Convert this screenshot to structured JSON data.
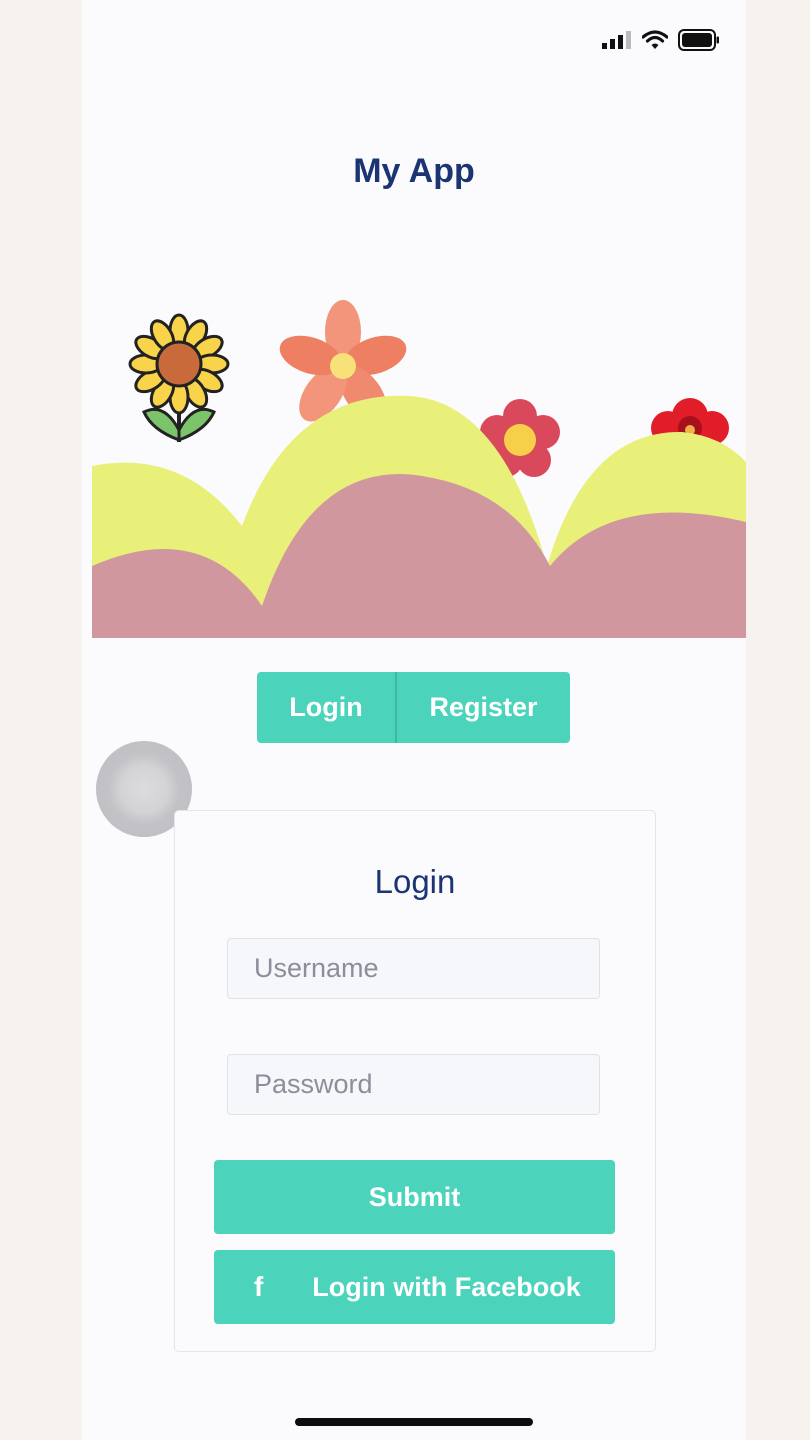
{
  "app": {
    "title": "My App"
  },
  "tabs": {
    "login_label": "Login",
    "register_label": "Register"
  },
  "login_card": {
    "title": "Login",
    "username_placeholder": "Username",
    "password_placeholder": "Password",
    "submit_label": "Submit",
    "facebook_label": "Login with Facebook",
    "facebook_icon": "f"
  },
  "colors": {
    "accent": "#4bd3bc",
    "title": "#1b3473",
    "hill_yellow": "#e8f07a",
    "hill_pink": "#d1979e"
  }
}
